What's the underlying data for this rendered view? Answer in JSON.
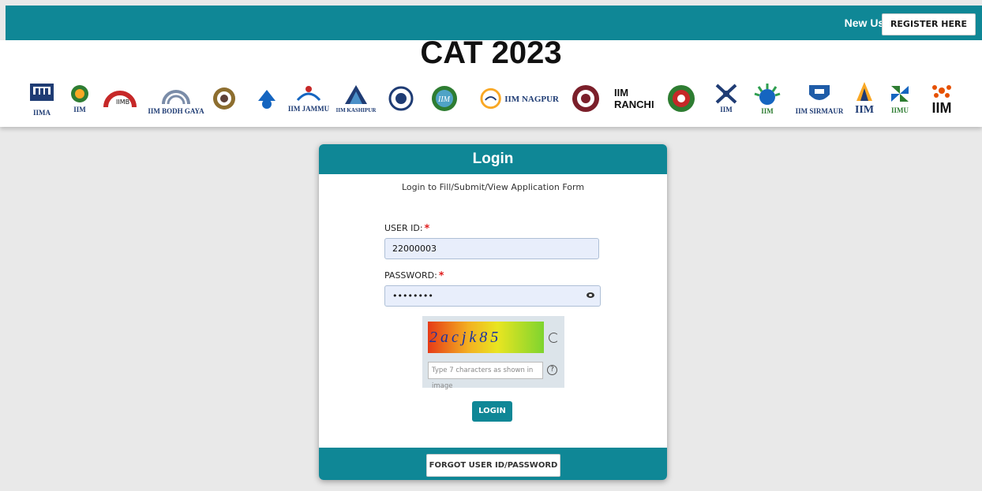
{
  "topbar": {
    "new_user_text": "New User?",
    "register_label": "REGISTER HERE"
  },
  "header": {
    "title": "CAT 2023",
    "logos": [
      {
        "icon": "iima-logo",
        "label": "IIMA"
      },
      {
        "icon": "iim-amritsar-logo",
        "label": "IIM"
      },
      {
        "icon": "iimb-logo",
        "label": "IIMB"
      },
      {
        "icon": "iim-bodh-gaya-logo",
        "label": "IIM BODH GAYA"
      },
      {
        "icon": "iim-calcutta-logo",
        "label": ""
      },
      {
        "icon": "iim-indore-logo",
        "label": ""
      },
      {
        "icon": "iim-jammu-logo",
        "label": "IIM JAMMU"
      },
      {
        "icon": "iim-kashipur-logo",
        "label": "IIM KASHIPUR"
      },
      {
        "icon": "iim-kozhikode-logo",
        "label": ""
      },
      {
        "icon": "iim-lucknow-logo",
        "label": "IIM"
      },
      {
        "icon": "iim-nagpur-logo",
        "label": "IIM NAGPUR"
      },
      {
        "icon": "iim-raipur-logo",
        "label": ""
      },
      {
        "icon": "iim-ranchi-logo",
        "label": "IIM RANCHI"
      },
      {
        "icon": "iim-rohtak-logo",
        "label": ""
      },
      {
        "icon": "iim-sambalpur-logo",
        "label": "IIM"
      },
      {
        "icon": "iim-shillong-logo",
        "label": "IIM"
      },
      {
        "icon": "iim-sirmaur-logo",
        "label": "IIM SIRMAUR"
      },
      {
        "icon": "iim-trichy-logo",
        "label": "IIM"
      },
      {
        "icon": "iimu-logo",
        "label": "IIMU"
      },
      {
        "icon": "iim-visakhapatnam-logo",
        "label": "IIM"
      }
    ]
  },
  "login": {
    "title": "Login",
    "subtitle": "Login to Fill/Submit/View Application Form",
    "user_id_label": "USER ID:",
    "user_id_value": "22000003",
    "password_label": "PASSWORD:",
    "password_value": "••••••••",
    "required_mark": "*",
    "captcha_text": "2acjk85",
    "captcha_placeholder": "Type 7 characters as shown in image",
    "help_symbol": "?",
    "login_button": "LOGIN",
    "forgot_button": "FORGOT USER ID/PASSWORD"
  },
  "colors": {
    "accent": "#0f8796",
    "background": "#e9e9e9",
    "required": "#e01e1e"
  }
}
